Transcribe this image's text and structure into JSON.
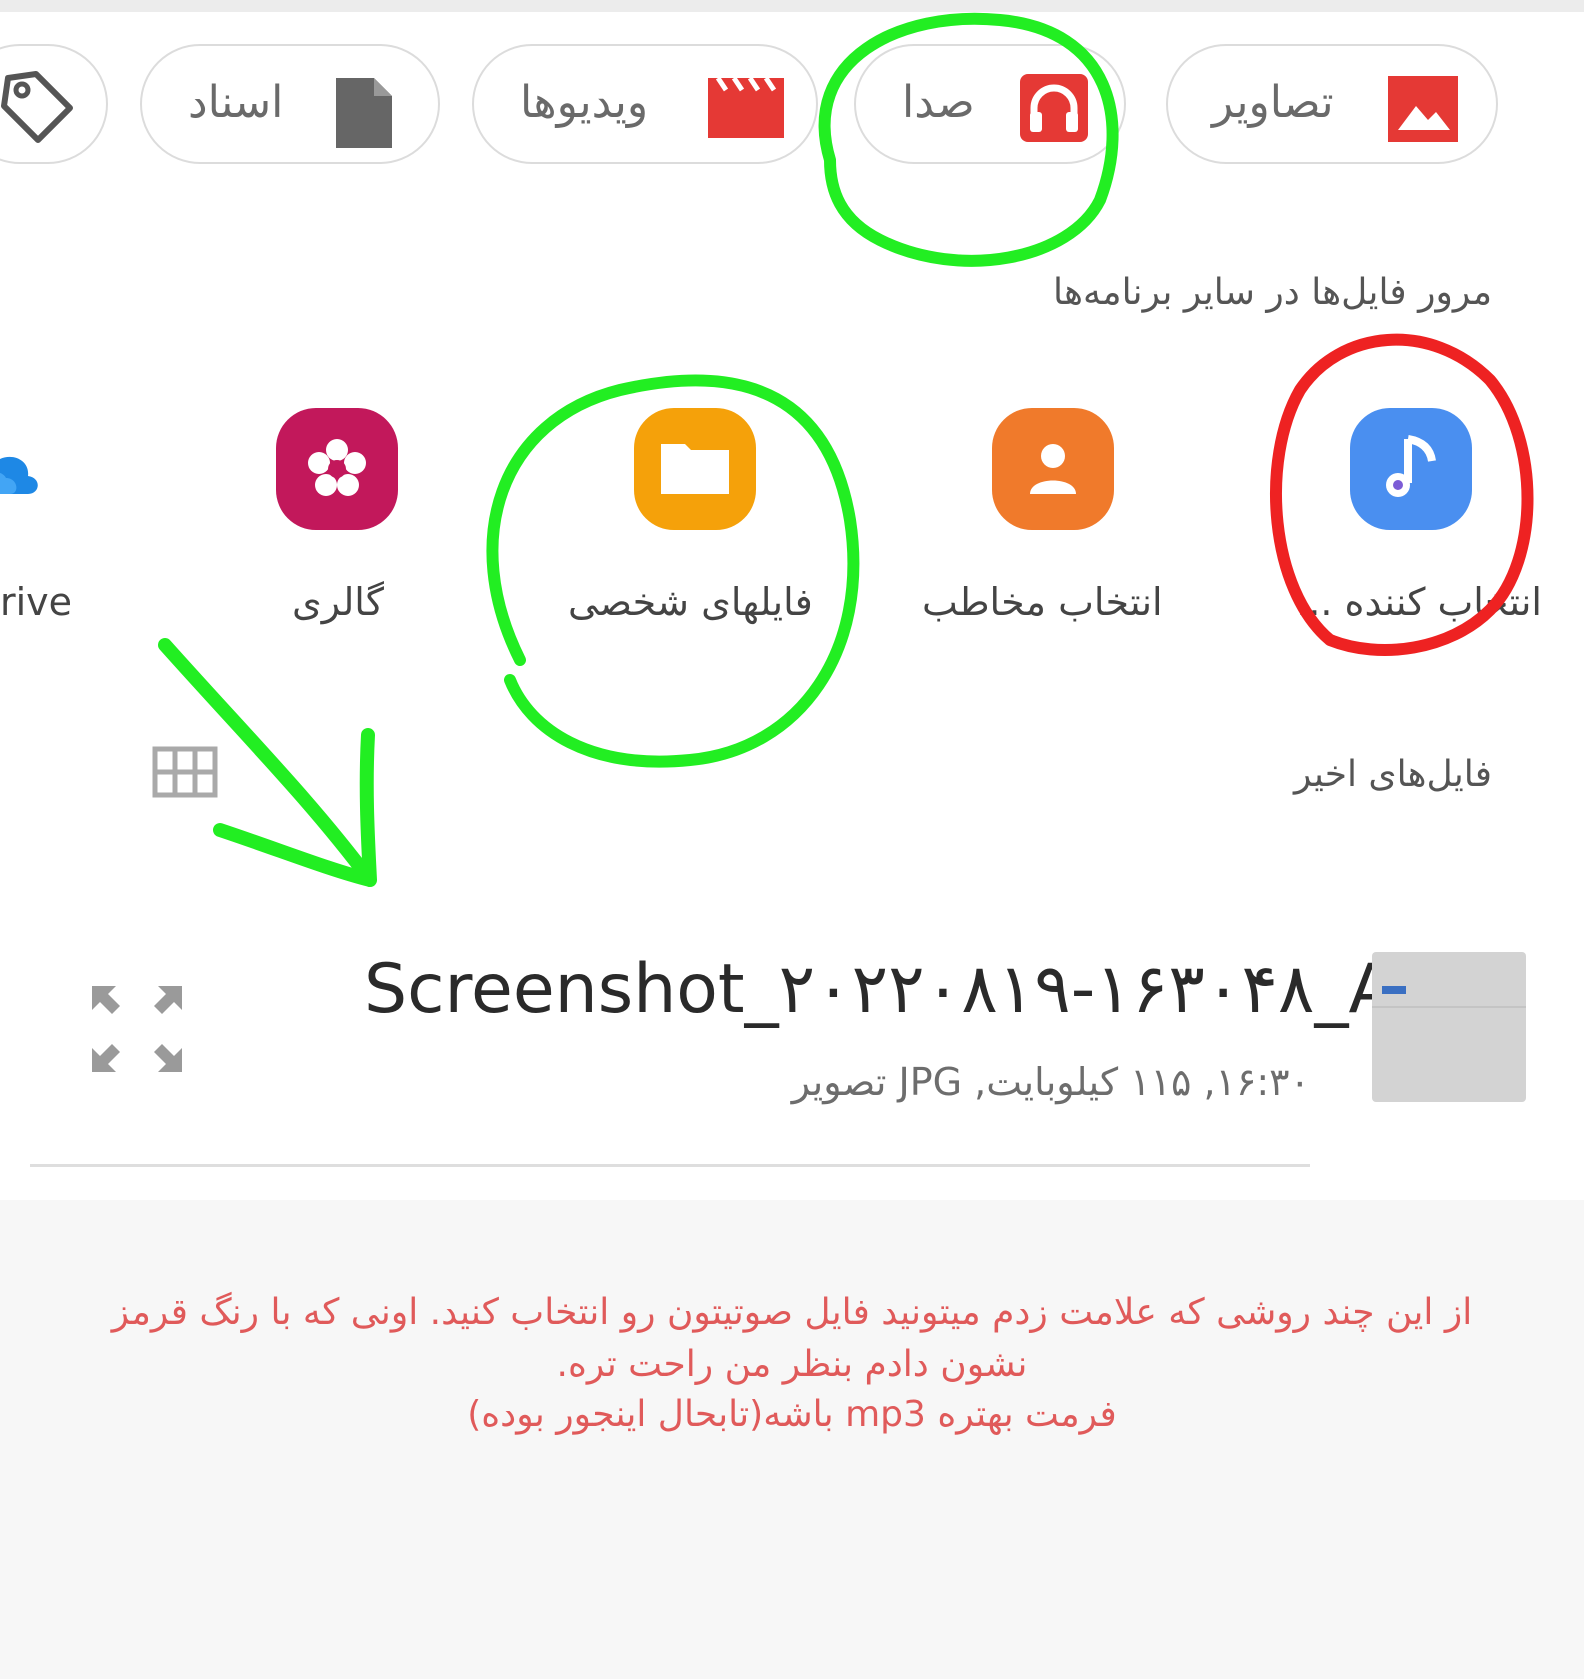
{
  "categories": {
    "images": "تصاویر",
    "audio": "صدا",
    "videos": "ویدیوها",
    "documents": "اسناد"
  },
  "browse_other_apps_title": "مرور فایل‌ها در سایر برنامه‌ها",
  "apps": {
    "sound_picker": "انتخاب کننده ...",
    "contact_picker": "انتخاب مخاطب",
    "my_files": "فایلهای شخصی",
    "gallery": "گالری",
    "onedrive": "rive"
  },
  "recent_files_title": "فایل‌های اخیر",
  "recent_file": {
    "name": "Screenshot_۲۰۲۲۰۸۱۹-۱۶۳۰۴۸_A...",
    "meta": "۱۶:۳۰, ۱۱۵ کیلوبایت, JPG تصویر"
  },
  "note": {
    "line1": "از این چند روشی که علامت زدم میتونید فایل صوتیتون رو انتخاب کنید. اونی که با رنگ قرمز",
    "line2": "نشون دادم بنظر من راحت تره.",
    "line3": "فرمت بهتره mp3 باشه(تابحال اینجور بوده)"
  },
  "colors": {
    "images_icon": "#e53935",
    "audio_icon": "#e53935",
    "videos_icon": "#e53935",
    "documents_icon": "#666666",
    "sound_picker_icon": "#4a8ff0",
    "contacts_icon": "#f07a2b",
    "my_files_icon": "#f5a10a",
    "gallery_icon": "#c2185b",
    "annotation_green": "#22ee22",
    "annotation_red": "#ee2222",
    "note_text": "#e05a5a"
  },
  "icons": {
    "images": "image-icon",
    "audio": "headphones-icon",
    "videos": "clapperboard-icon",
    "documents": "document-icon",
    "tags": "tag-icon",
    "grid_view": "grid-icon",
    "expand": "expand-icon"
  }
}
